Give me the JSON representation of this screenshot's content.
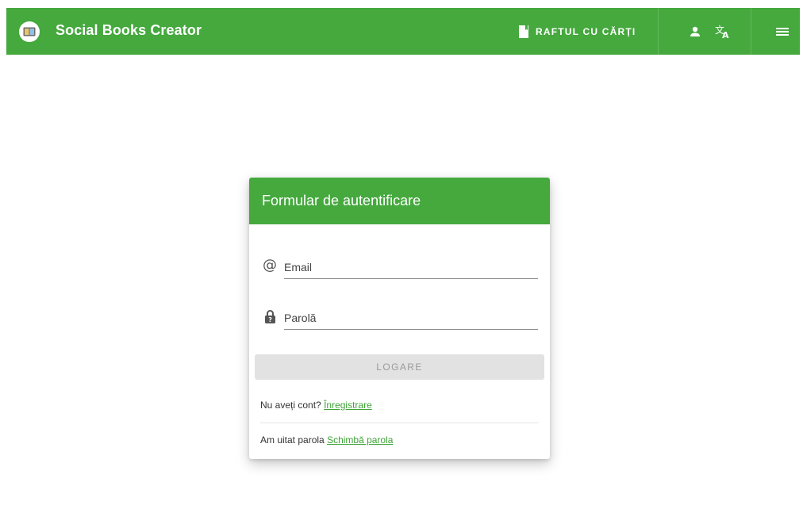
{
  "header": {
    "app_title": "Social Books Creator",
    "shelf_label": "RAFTUL CU CĂRȚI",
    "icons": [
      "book-logo-icon",
      "book-icon",
      "person-icon",
      "translate-icon",
      "menu-icon"
    ],
    "accent_color": "#45a93e"
  },
  "login": {
    "title": "Formular de autentificare",
    "email_placeholder": "Email",
    "password_placeholder": "Parolă",
    "submit_label": "LOGARE",
    "register_prompt": "Nu aveți cont?",
    "register_link": "Înregistrare",
    "forgot_prompt": "Am uitat parola",
    "forgot_link": "Schimbă parola"
  }
}
